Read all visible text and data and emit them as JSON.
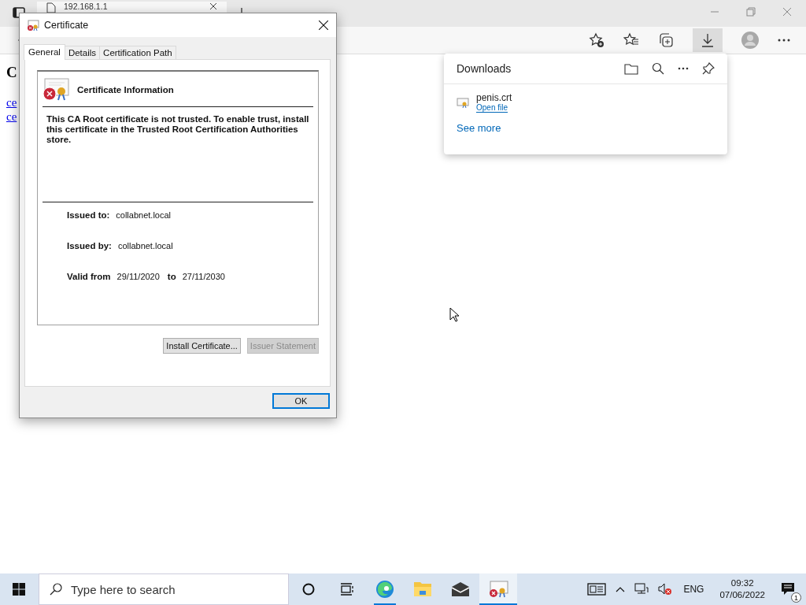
{
  "browser": {
    "tab": {
      "title": "192.168.1.1"
    },
    "page": {
      "heading": "C",
      "links": [
        "ce",
        "ce"
      ]
    }
  },
  "dialog": {
    "title": "Certificate",
    "tabs": [
      {
        "label": "General",
        "selected": true
      },
      {
        "label": "Details",
        "selected": false
      },
      {
        "label": "Certification Path",
        "selected": false
      }
    ],
    "info_title": "Certificate Information",
    "message": "This CA Root certificate is not trusted. To enable trust, install this certificate in the Trusted Root Certification Authorities store.",
    "fields": [
      {
        "label": "Issued to:",
        "value": "collabnet.local"
      },
      {
        "label": "Issued by:",
        "value": "collabnet.local"
      }
    ],
    "validity": {
      "label": "Valid from",
      "from": "29/11/2020",
      "to_label": "to",
      "to": "27/11/2030"
    },
    "buttons": [
      {
        "label": "Install Certificate...",
        "disabled": false
      },
      {
        "label": "Issuer Statement",
        "disabled": true
      }
    ],
    "ok": "OK"
  },
  "downloads": {
    "title": "Downloads",
    "items": [
      {
        "name": "penis.crt",
        "action": "Open file"
      }
    ],
    "see_more": "See more"
  },
  "taskbar": {
    "search": {
      "placeholder": "Type here to search"
    },
    "apps": [
      {
        "kind": "edge",
        "running": true,
        "active": false
      },
      {
        "kind": "explorer",
        "running": false,
        "active": false
      },
      {
        "kind": "mail",
        "running": false,
        "active": false
      },
      {
        "kind": "certificate",
        "running": true,
        "active": true
      }
    ],
    "language": "ENG",
    "time": "09:32",
    "date": "07/06/2022",
    "notifications": "1"
  }
}
